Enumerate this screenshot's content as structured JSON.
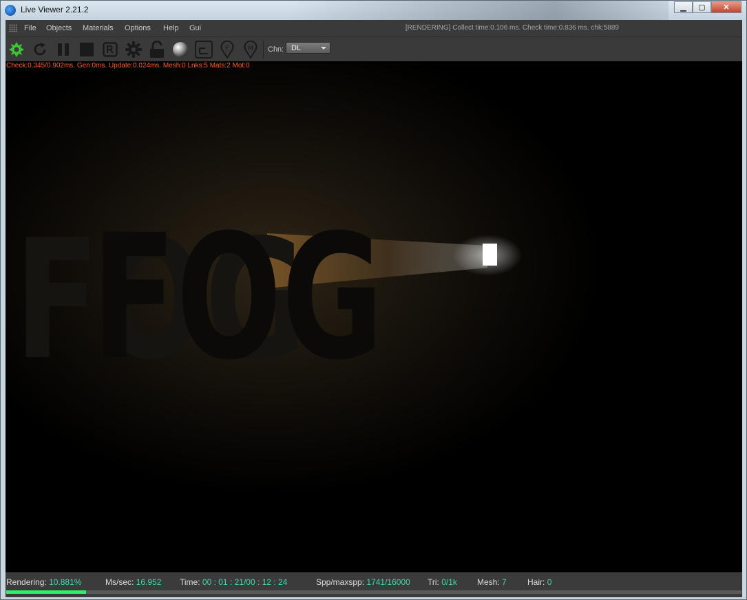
{
  "window": {
    "title": "Live Viewer 2.21.2",
    "controls": {
      "minimize": "▁",
      "maximize": "▢",
      "close": "✕"
    }
  },
  "menubar": {
    "items": [
      "File",
      "Objects",
      "Materials",
      "Options",
      "Help",
      "Gui"
    ],
    "status": "[RENDERING] Collect time:0.106 ms.  Check time:0.836 ms.  chk:5889"
  },
  "toolbar": {
    "buttons": [
      "octane-logo-icon",
      "refresh-icon",
      "pause-icon",
      "stop-icon",
      "render-region-icon",
      "settings-gear-icon",
      "lock-icon",
      "material-ball-icon",
      "region-select-icon",
      "focus-pin-icon",
      "material-pin-icon"
    ],
    "channel_label": "Chn:",
    "channel_value": "DL"
  },
  "viewport": {
    "stats": "Check:0.345/0.902ms. Gen:0ms. Update:0.024ms. Mesh:0 Lnks:5 Mats:2 Mot:0",
    "render_text": "FOG"
  },
  "statusbar": {
    "rendering_label": "Rendering:",
    "rendering_value": "10.881%",
    "mssec_label": "Ms/sec:",
    "mssec_value": "16.952",
    "time_label": "Time:",
    "time_value": "00 : 01 : 21/00 : 12 : 24",
    "spp_label": "Spp/maxspp:",
    "spp_value": "1741/16000",
    "tri_label": "Tri:",
    "tri_value": "0/1k",
    "mesh_label": "Mesh:",
    "mesh_value": "7",
    "hair_label": "Hair:",
    "hair_value": "0",
    "progress_fraction": 0.10881
  },
  "colors": {
    "stats_text": "#ff5a2c",
    "status_value": "#43d8b0",
    "progress": "#2ef06a",
    "logo_green": "#3fc435"
  }
}
